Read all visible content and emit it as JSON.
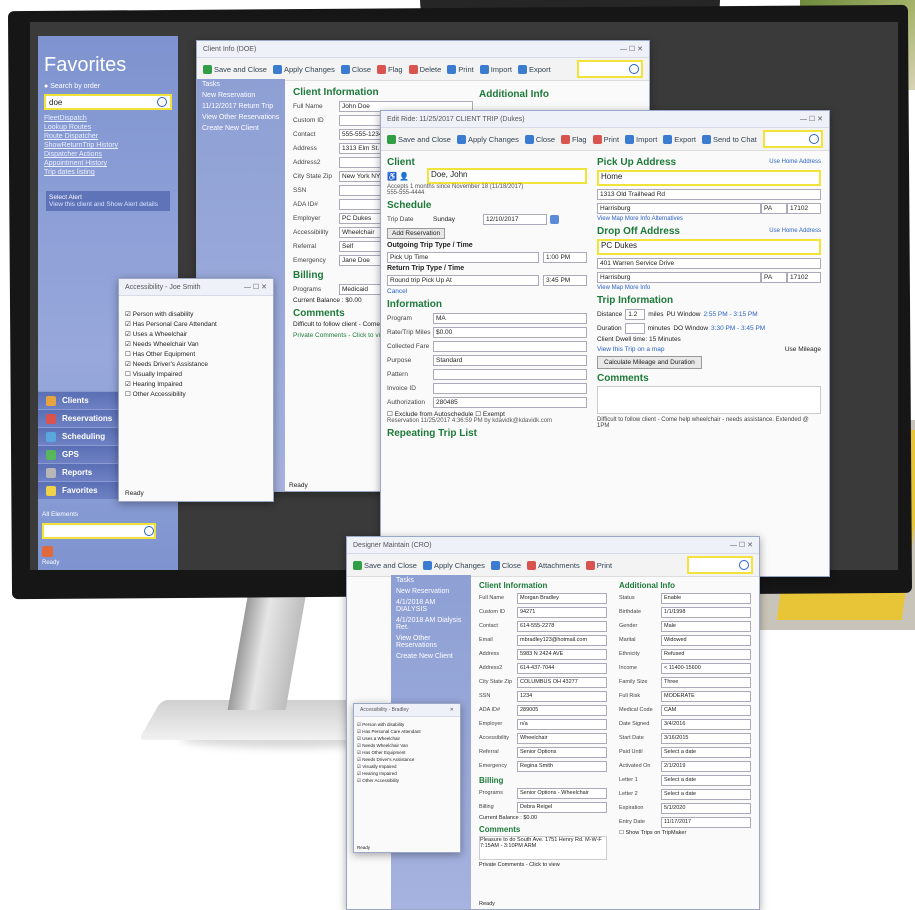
{
  "favorites": {
    "title": "Favorites",
    "search_value": "doe",
    "radio_label": "Search by order",
    "links": [
      "FleetDispatch",
      "Lookup Routes",
      "Route Dispatcher",
      "ShowReturnTrip History",
      "Dispatcher Actions",
      "Appointment History",
      "Trip dates listing"
    ],
    "alert_text": "Select Alert",
    "alert_sub": "View this client and Show Alert details",
    "nav": [
      {
        "label": "Clients",
        "color": "#e8a341"
      },
      {
        "label": "Reservations",
        "color": "#d9534f"
      },
      {
        "label": "Scheduling",
        "color": "#5aa7e0"
      },
      {
        "label": "GPS",
        "color": "#57b85b"
      },
      {
        "label": "Reports",
        "color": "#b7b7b7"
      },
      {
        "label": "Favorites",
        "color": "#f0d24a"
      }
    ],
    "all_elements": "All Elements",
    "status": "Ready"
  },
  "accessibility_dialog": {
    "title": "Accessibility - Joe Smith",
    "items": [
      {
        "label": "Person with disability",
        "checked": true
      },
      {
        "label": "Has Personal Care Attendant",
        "checked": true
      },
      {
        "label": "Uses a Wheelchair",
        "checked": true
      },
      {
        "label": "Needs Wheelchair Van",
        "checked": true
      },
      {
        "label": "Has Other Equipment",
        "checked": false
      },
      {
        "label": "Needs Driver's Assistance",
        "checked": true
      },
      {
        "label": "Visually Impaired",
        "checked": false
      },
      {
        "label": "Hearing Impaired",
        "checked": true
      },
      {
        "label": "Other Accessibility",
        "checked": false
      }
    ],
    "wheelchair_type_label": "Wheelchair Type",
    "wheelchair_type": "Standard",
    "equipment_type_label": "Equipment Type",
    "equipment_type": "Other",
    "description_label": "Description",
    "status": "Ready"
  },
  "client_window": {
    "title": "Client Info (DOE)",
    "toolbar": [
      "Save and Close",
      "Apply Changes",
      "Close",
      "Flag",
      "Delete",
      "Print",
      "Import",
      "Export"
    ],
    "tasks": [
      "Tasks",
      "New Reservation",
      "11/12/2017 Return Trip",
      "View Other Reservations",
      "Create New Client"
    ],
    "section_title": "Client Information",
    "additional_title": "Additional Info",
    "fields": [
      {
        "label": "Full Name",
        "value": "John Doe"
      },
      {
        "label": "Custom ID",
        "value": ""
      },
      {
        "label": "Contact",
        "value": "555-555-1234"
      },
      {
        "label": "Address",
        "value": "1313 Elm St."
      },
      {
        "label": "Address2",
        "value": ""
      },
      {
        "label": "City State Zip",
        "value": "New York NY"
      },
      {
        "label": "SSN",
        "value": ""
      },
      {
        "label": "ADA ID#",
        "value": ""
      },
      {
        "label": "Employer",
        "value": "PC Dukes"
      },
      {
        "label": "Accessibility",
        "value": "Wheelchair"
      },
      {
        "label": "Referral",
        "value": "Self"
      },
      {
        "label": "Emergency",
        "value": "Jane Doe"
      }
    ],
    "billing_title": "Billing",
    "billing_program": "Medicaid",
    "current_balance": "Current Balance : $0.00",
    "comments_title": "Comments",
    "comments": "Difficult to follow client - Come help wheelchair",
    "private_comments": "Private Comments - Click to view",
    "status": "Ready"
  },
  "reservation_window": {
    "title": "Edit Ride: 11/25/2017 CLIENT TRIP (Dukes)",
    "toolbar": [
      "Save and Close",
      "Apply Changes",
      "Close",
      "Flag",
      "Print",
      "Import",
      "Export",
      "Send to Chat"
    ],
    "client_label": "Client",
    "client_value": "Doe, John",
    "client_sub": "Accepts 1 months since November 18 (11/18/2017)",
    "client_phone": "555-555-4444",
    "schedule_title": "Schedule",
    "trip_date_label": "Trip Date",
    "trip_day": "Sunday",
    "trip_date": "12/10/2017",
    "add_reservation": "Add Reservation",
    "outgoing_title": "Outgoing Trip Type / Time",
    "outgoing_type": "Pick Up Time",
    "outgoing_time": "1:00 PM",
    "return_title": "Return Trip Type / Time",
    "return_type": "Round trip Pick Up At",
    "return_time": "3:45 PM",
    "cancel_link": "Cancel",
    "information_title": "Information",
    "info_fields": [
      {
        "label": "Program",
        "value": "MA"
      },
      {
        "label": "Rate/Trip Miles",
        "value": "$0.00"
      },
      {
        "label": "Collected Fare",
        "value": ""
      },
      {
        "label": "Purpose",
        "value": "Standard"
      },
      {
        "label": "Pattern",
        "value": ""
      },
      {
        "label": "Invoice ID",
        "value": ""
      },
      {
        "label": "Authorization",
        "value": "280485"
      }
    ],
    "has_pca": "Has PCA",
    "exclude_label": "Exclude from Autoschedule",
    "exempt_label": "Exempt",
    "provider_note": "Reservation 11/25/2017 4:36:59 PM by kdavidk@kdavidk.com",
    "repeating_title": "Repeating Trip List",
    "pickup_title": "Pick Up Address",
    "pickup_link": "Use Home Address",
    "pickup_name": "Home",
    "pickup_street": "1313 Old Trailhead Rd",
    "pickup_city": "Harrisburg",
    "pickup_state": "PA",
    "pickup_zip": "17102",
    "pickup_links": "View Map  More Info  Alternatives",
    "dropoff_title": "Drop Off Address",
    "dropoff_link": "Use Home Address",
    "dropoff_name": "PC Dukes",
    "dropoff_street": "401 Warren Service Drive",
    "dropoff_city": "Harrisburg",
    "dropoff_state": "PA",
    "dropoff_zip": "17102",
    "dropoff_links": "View Map  More Info",
    "trip_info_title": "Trip Information",
    "distance_label": "Distance",
    "distance_value": "1.2",
    "distance_unit": "miles",
    "duration_label": "Duration",
    "duration_value": "",
    "duration_unit": "minutes",
    "window_label_1": "PU Window",
    "window_val_1": "2:55 PM - 3:15 PM",
    "window_label_2": "DO Window",
    "window_val_2": "3:30 PM - 3:45 PM",
    "client_dwell": "Client Dwell time: 15 Minutes",
    "view_trip_link": "View this Trip on a map",
    "use_mileage": "Use Mileage",
    "calc_button": "Calculate Mileage and Duration",
    "comments_title": "Comments",
    "comments_text": "Difficult to follow client - Come help wheelchair - needs assistance. Extended @ 1PM"
  },
  "front_window": {
    "title": "Designer Maintain (CRO)",
    "toolbar": [
      "Save and Close",
      "Apply Changes",
      "Close",
      "Attachments",
      "Print"
    ],
    "tasks": [
      "Tasks",
      "New Reservation",
      "4/1/2018 AM DIALYSIS",
      "4/1/2018 AM Dialysis Ret.",
      "View Other Reservations",
      "Create New Client"
    ],
    "client_info_title": "Client Information",
    "fields": [
      {
        "label": "Full Name",
        "value": "Morgan Bradley"
      },
      {
        "label": "Custom ID",
        "value": "94271"
      },
      {
        "label": "Contact",
        "value": "614-555-2278"
      },
      {
        "label": "Email",
        "value": "mbradley123@hotmail.com"
      },
      {
        "label": "Address",
        "value": "5983 N 2424 AVE"
      },
      {
        "label": "Address2",
        "value": "614-437-7044"
      },
      {
        "label": "City State Zip",
        "value": "COLUMBUS  OH  43277"
      },
      {
        "label": "SSN",
        "value": "1234"
      },
      {
        "label": "ADA ID#",
        "value": "289005"
      },
      {
        "label": "Employer",
        "value": "n/a"
      },
      {
        "label": "Accessibility",
        "value": "Wheelchair"
      },
      {
        "label": "Referral",
        "value": "Senior Options"
      },
      {
        "label": "Emergency",
        "value": "Regina Smith"
      }
    ],
    "view_map": "View Map  More Info",
    "adrm_registered": "Is ADRM Registered?",
    "billing_title": "Billing",
    "billing_fields": [
      {
        "label": "Programs",
        "value": "Senior Options - Wheelchair"
      },
      {
        "label": "Billing",
        "value": "Debra Reigel"
      }
    ],
    "current_balance": "Current Balance : $0.00",
    "comments_title": "Comments",
    "comments_text": "Pleasure to do South Ave. 1751 Henry Rd. M-W-F 7:15AM - 3:10PM ARM",
    "private_comments": "Private Comments - Click to view",
    "status": "Ready",
    "additional_title": "Additional Info",
    "additional": [
      {
        "label": "Status",
        "value": "Enable"
      },
      {
        "label": "Birthdate",
        "value": "1/1/1998"
      },
      {
        "label": "Gender",
        "value": "Male"
      },
      {
        "label": "Marital",
        "value": "Widowed"
      },
      {
        "label": "Ethnicity",
        "value": "Refused"
      },
      {
        "label": "Income",
        "value": "< 11400-15600"
      },
      {
        "label": "Family Size",
        "value": "Three"
      },
      {
        "label": "Full Risk",
        "value": "MODERATE"
      },
      {
        "label": "Medical Code",
        "value": "CAM"
      },
      {
        "label": "Date Signed",
        "value": "3/4/2016"
      },
      {
        "label": "Start Date",
        "value": "3/16/2015"
      },
      {
        "label": "Paid Until",
        "value": "Select a date"
      },
      {
        "label": "Activated On",
        "value": "2/1/2019"
      },
      {
        "label": "Letter 1",
        "value": "Select a date"
      },
      {
        "label": "Letter 2",
        "value": "Select a date"
      },
      {
        "label": "Expiration",
        "value": "5/1/2020"
      },
      {
        "label": "Entry Date",
        "value": "11/17/2017"
      }
    ],
    "record_video": "Record Video",
    "received_hipaa": "Received HIPAA",
    "show_trips": "Show Trips on TripMaker"
  },
  "small_dialog": {
    "title": "Accessibility - Bradley",
    "items": [
      "Person with disability",
      "Has Personal Care Attendant",
      "Uses a Wheelchair",
      "Needs Wheelchair Van",
      "Has Other Equipment",
      "Needs Driver's Assistance",
      "Visually Impaired",
      "Hearing Impaired",
      "Other Accessibility"
    ],
    "wheelchair_type_label": "Wheelchair Type",
    "wheelchair_type": "Standard",
    "equipment_type_label": "Equipment Type",
    "equipment_type": "Oxygen Holder",
    "seat_label": "Seat Type Used",
    "seat_value": "50",
    "description_label": "Description",
    "description_value": "Extension",
    "status": "Ready"
  }
}
